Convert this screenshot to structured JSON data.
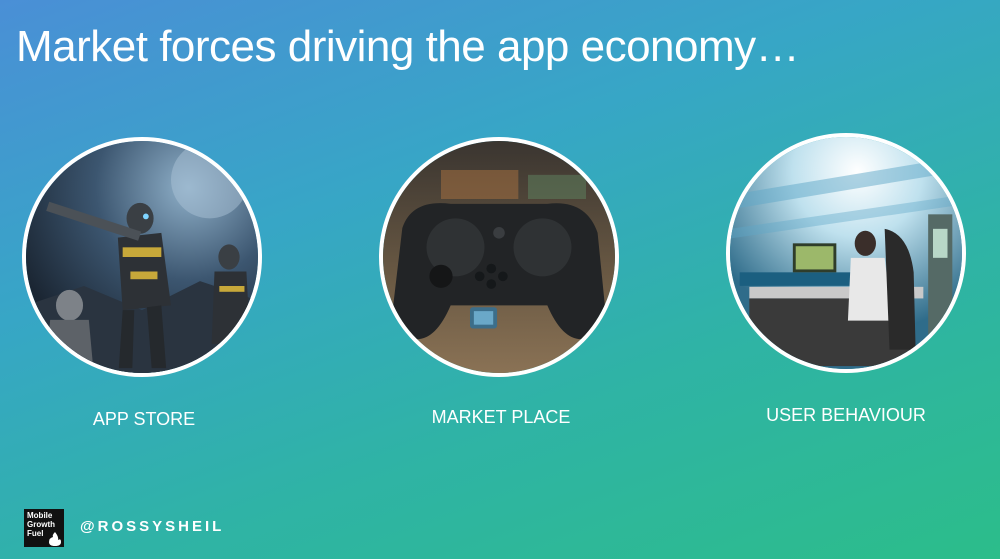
{
  "slide": {
    "title": "Market forces driving the app economy…"
  },
  "items": [
    {
      "caption": "APP STORE",
      "image": "armored-soldiers-game-scene"
    },
    {
      "caption": "MARKET PLACE",
      "image": "game-controller"
    },
    {
      "caption": "USER BEHAVIOUR",
      "image": "esports-gamer-arena"
    }
  ],
  "footer": {
    "logo_lines": [
      "Mobile",
      "Growth",
      "Fuel"
    ],
    "handle": "@ROSSYSHEIL"
  }
}
